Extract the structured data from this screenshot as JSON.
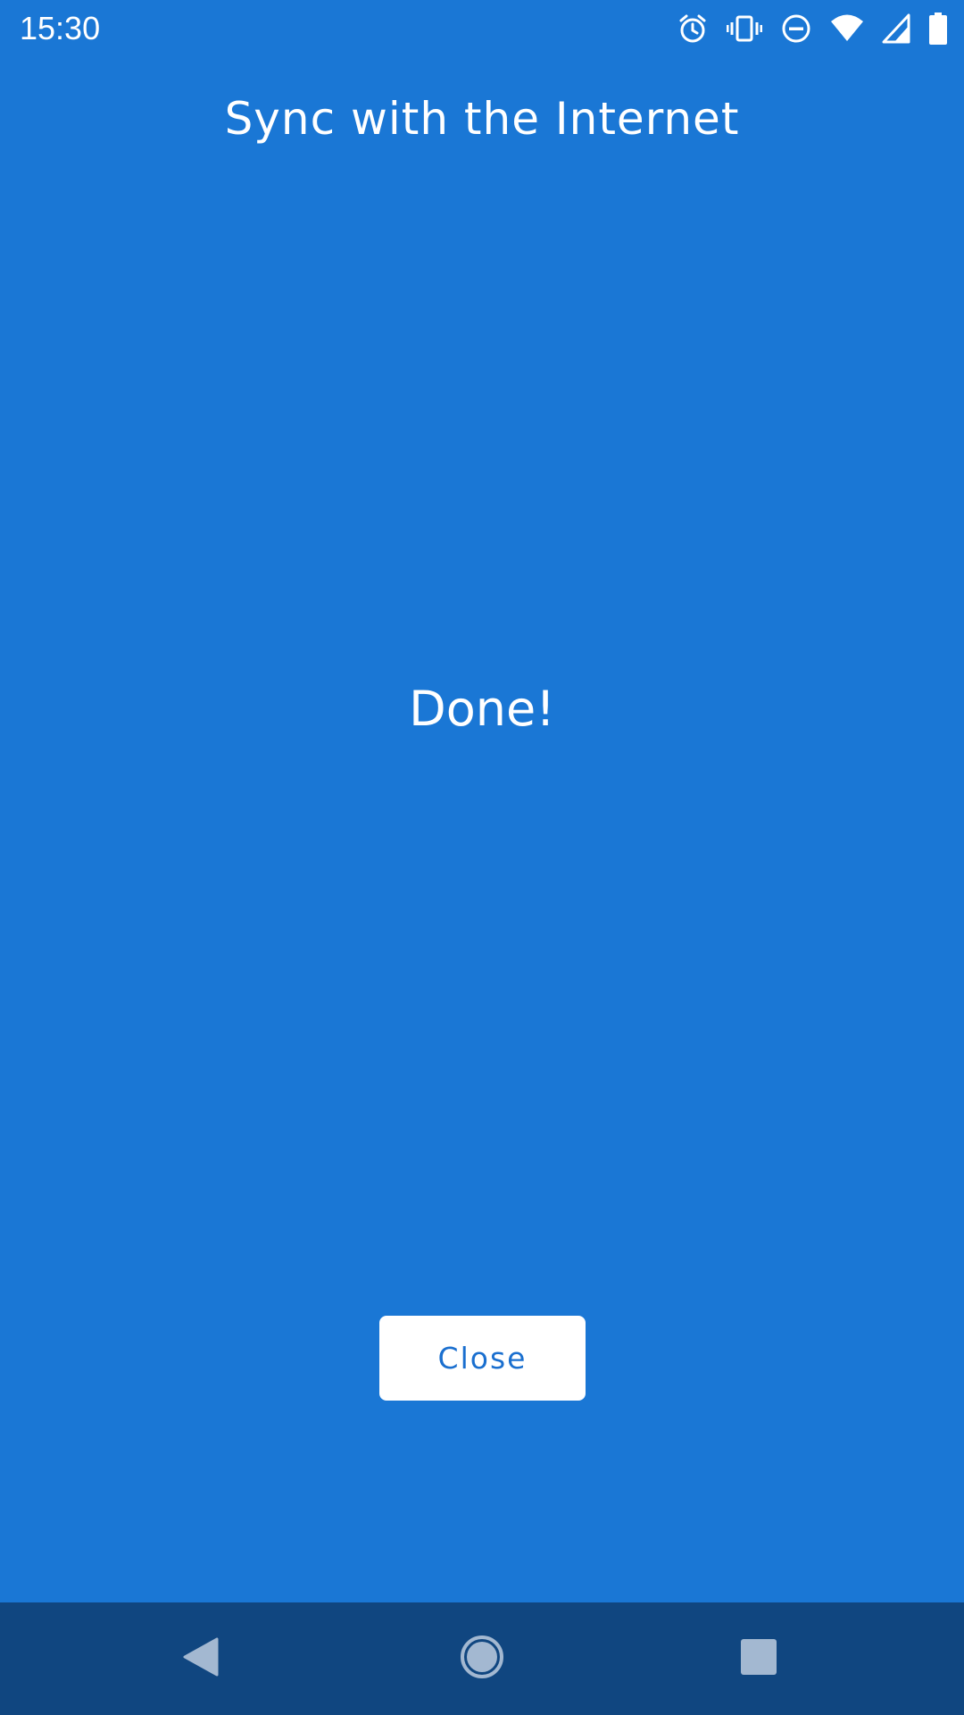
{
  "status_bar": {
    "time": "15:30",
    "icons": [
      "alarm-icon",
      "vibrate-icon",
      "do-not-disturb-icon",
      "wifi-icon",
      "cell-signal-icon",
      "battery-icon"
    ]
  },
  "header": {
    "title": "Sync with the Internet"
  },
  "main": {
    "status_message": "Done!"
  },
  "actions": {
    "close_label": "Close"
  },
  "nav_bar": {
    "icons": [
      "back-icon",
      "home-icon",
      "recents-icon"
    ]
  },
  "colors": {
    "background": "#1a77d5",
    "nav_bar": "#104680",
    "button_background": "#ffffff",
    "button_text": "#1a6fcf",
    "text": "#ffffff"
  }
}
